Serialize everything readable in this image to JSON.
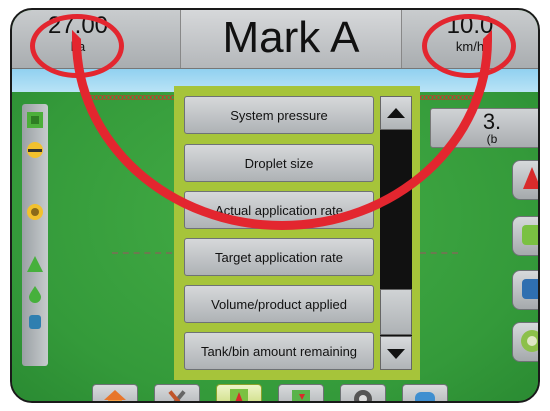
{
  "header": {
    "left_stat": {
      "value": "27.00",
      "unit": "ha"
    },
    "title": "Mark A",
    "right_stat": {
      "value": "10.0",
      "unit": "km/h"
    }
  },
  "right_panel": {
    "value": "3.",
    "unit": "(b"
  },
  "dropdown": {
    "items": [
      {
        "label": "System pressure"
      },
      {
        "label": "Droplet size"
      },
      {
        "label": "Actual application rate"
      },
      {
        "label": "Target application rate"
      },
      {
        "label": "Volume/product applied"
      },
      {
        "label": "Tank/bin amount remaining"
      }
    ]
  },
  "bottom_tabs": [
    "home-icon",
    "tools-icon",
    "guidance-icon",
    "field-icon",
    "gauge-icon",
    "cloud-icon"
  ],
  "colors": {
    "highlight": "#e3262f",
    "accent": "#a6c43a",
    "field": "#3aa042",
    "sky": "#8fd0f0"
  }
}
